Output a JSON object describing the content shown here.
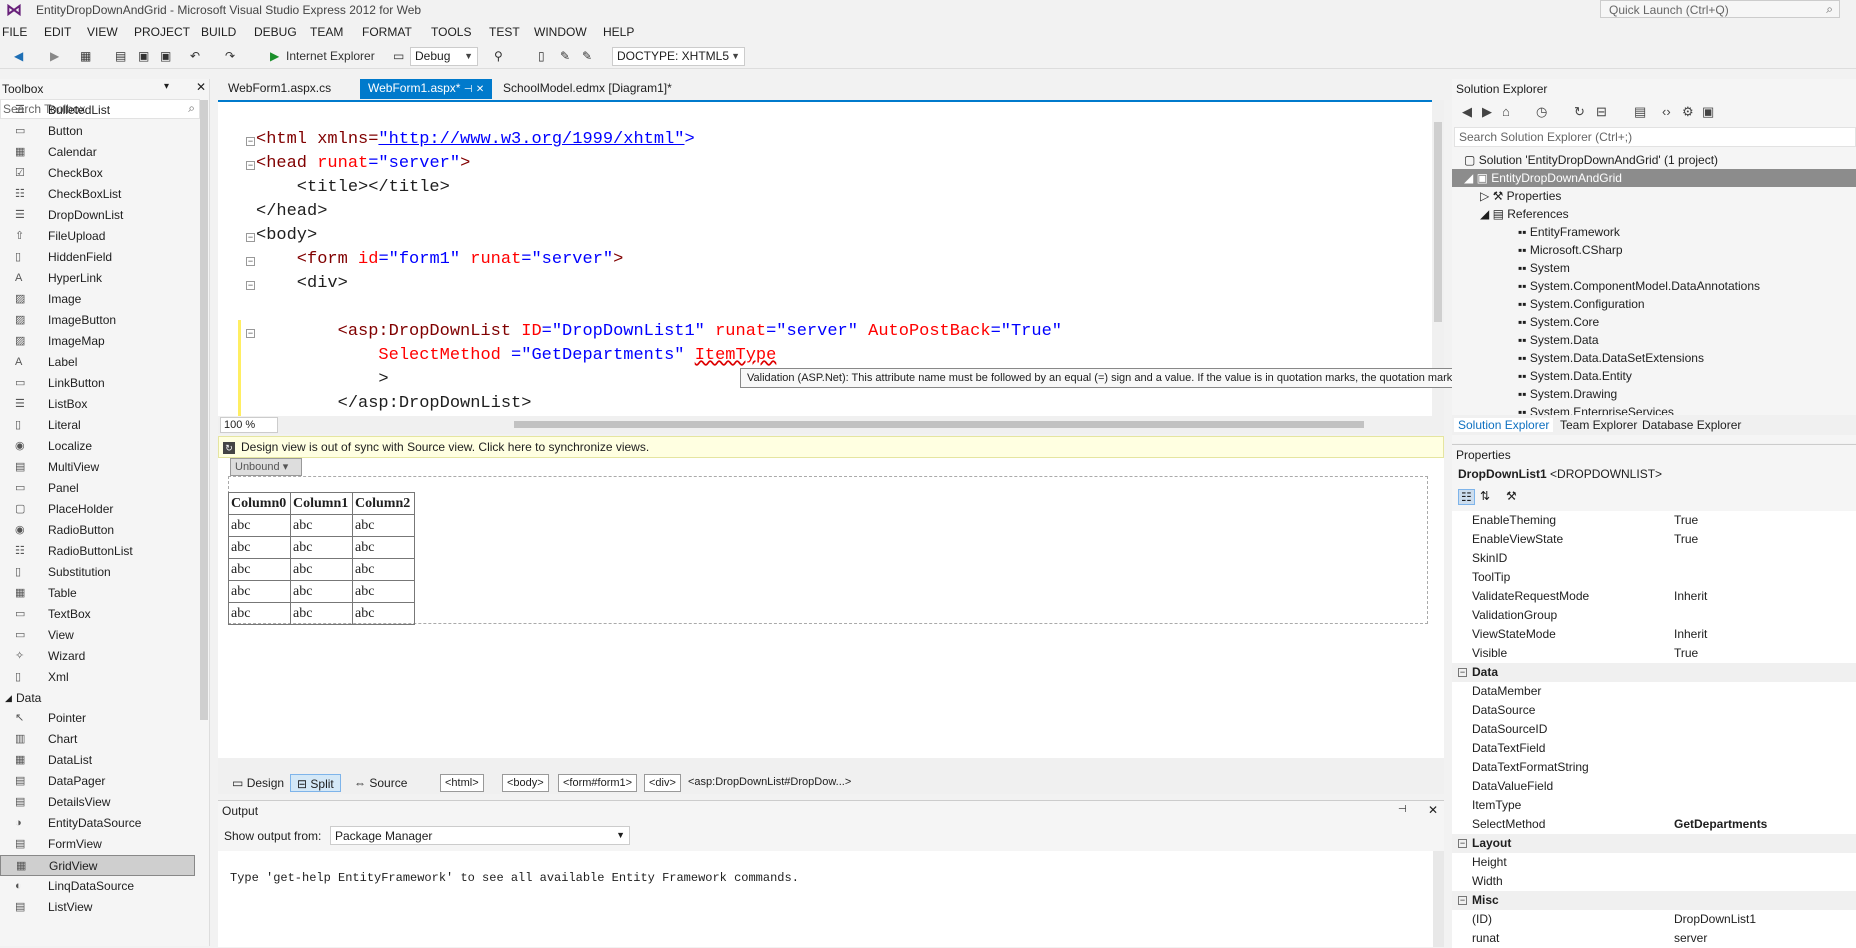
{
  "window": {
    "title": "EntityDropDownAndGrid - Microsoft Visual Studio Express 2012 for Web",
    "quick_launch": "Quick Launch (Ctrl+Q)"
  },
  "menu": [
    "FILE",
    "EDIT",
    "VIEW",
    "PROJECT",
    "BUILD",
    "DEBUG",
    "TEAM",
    "FORMAT",
    "TOOLS",
    "TEST",
    "WINDOW",
    "HELP"
  ],
  "toolbar": {
    "run_label": "Internet Explorer",
    "config": "Debug",
    "doctype": "DOCTYPE: XHTML5"
  },
  "toolbox": {
    "title": "Toolbox",
    "search_placeholder": "Search Toolbox",
    "standard_items": [
      "BulletedList",
      "Button",
      "Calendar",
      "CheckBox",
      "CheckBoxList",
      "DropDownList",
      "FileUpload",
      "HiddenField",
      "HyperLink",
      "Image",
      "ImageButton",
      "ImageMap",
      "Label",
      "LinkButton",
      "ListBox",
      "Literal",
      "Localize",
      "MultiView",
      "Panel",
      "PlaceHolder",
      "RadioButton",
      "RadioButtonList",
      "Substitution",
      "Table",
      "TextBox",
      "View",
      "Wizard",
      "Xml"
    ],
    "data_group": "Data",
    "data_items": [
      "Pointer",
      "Chart",
      "DataList",
      "DataPager",
      "DetailsView",
      "EntityDataSource",
      "FormView",
      "GridView",
      "LinqDataSource",
      "ListView"
    ]
  },
  "tabs": [
    {
      "label": "WebForm1.aspx.cs"
    },
    {
      "label": "WebForm1.aspx*"
    },
    {
      "label": "SchoolModel.edmx [Diagram1]*"
    }
  ],
  "code": {
    "l1_tag": "<html xmlns=",
    "l1_url": "\"http://www.w3.org/1999/xhtml\"",
    "l1_end": ">",
    "l2a": "<head ",
    "l2b": "runat",
    "l2c": "=\"server\"",
    "l2d": ">",
    "l3": "    <title></title>",
    "l4": "</head>",
    "l5": "<body>",
    "l6a": "    <form ",
    "l6b": "id",
    "l6c": "=\"form1\" ",
    "l6d": "runat",
    "l6e": "=\"server\"",
    "l6f": ">",
    "l7": "    <div>",
    "l8a": "        <asp:DropDownList ",
    "l8b": "ID",
    "l8c": "=\"DropDownList1\" ",
    "l8d": "runat",
    "l8e": "=\"server\" ",
    "l8f": "AutoPostBack",
    "l8g": "=\"True\"",
    "l9a": "            ",
    "l9b": "SelectMethod ",
    "l9c": "=\"GetDepartments\" ",
    "l9d": "ItemType",
    "l10": "            >",
    "l11": "        </asp:DropDownList>"
  },
  "tooltip": "Validation (ASP.Net): This attribute name must be followed by an equal (=) sign and a value. If the value is in quotation marks, the quotation marks must match.",
  "zoom": "100 %",
  "sync_message": "Design view is out of sync with Source view. Click here to synchronize views.",
  "design": {
    "dropdown": "Unbound",
    "grid_headers": [
      "Column0",
      "Column1",
      "Column2"
    ],
    "grid_rows": [
      [
        "abc",
        "abc",
        "abc"
      ],
      [
        "abc",
        "abc",
        "abc"
      ],
      [
        "abc",
        "abc",
        "abc"
      ],
      [
        "abc",
        "abc",
        "abc"
      ],
      [
        "abc",
        "abc",
        "abc"
      ]
    ]
  },
  "viewbar": {
    "design": "Design",
    "split": "Split",
    "source": "Source",
    "crumbs": [
      "<html>",
      "<body>",
      "<form#form1>",
      "<div>",
      "<asp:DropDownList#DropDow...>"
    ]
  },
  "output": {
    "title": "Output",
    "show_from": "Show output from:",
    "source": "Package Manager",
    "text": "Type 'get-help EntityFramework' to see all available Entity Framework commands."
  },
  "solution_explorer": {
    "title": "Solution Explorer",
    "search": "Search Solution Explorer (Ctrl+;)",
    "solution": "Solution 'EntityDropDownAndGrid' (1 project)",
    "project": "EntityDropDownAndGrid",
    "properties": "Properties",
    "references": "References",
    "refs": [
      "EntityFramework",
      "Microsoft.CSharp",
      "System",
      "System.ComponentModel.DataAnnotations",
      "System.Configuration",
      "System.Core",
      "System.Data",
      "System.Data.DataSetExtensions",
      "System.Data.Entity",
      "System.Drawing",
      "System.EnterpriseServices"
    ],
    "tabs": [
      "Solution Explorer",
      "Team Explorer",
      "Database Explorer"
    ]
  },
  "properties": {
    "title": "Properties",
    "object_name": "DropDownList1",
    "object_type": "<DROPDOWNLIST>",
    "rows_top": [
      {
        "n": "EnableTheming",
        "v": "True"
      },
      {
        "n": "EnableViewState",
        "v": "True"
      },
      {
        "n": "SkinID",
        "v": ""
      },
      {
        "n": "ToolTip",
        "v": ""
      },
      {
        "n": "ValidateRequestMode",
        "v": "Inherit"
      },
      {
        "n": "ValidationGroup",
        "v": ""
      },
      {
        "n": "ViewStateMode",
        "v": "Inherit"
      },
      {
        "n": "Visible",
        "v": "True"
      }
    ],
    "cat_data": "Data",
    "rows_data": [
      {
        "n": "DataMember",
        "v": ""
      },
      {
        "n": "DataSource",
        "v": ""
      },
      {
        "n": "DataSourceID",
        "v": ""
      },
      {
        "n": "DataTextField",
        "v": ""
      },
      {
        "n": "DataTextFormatString",
        "v": ""
      },
      {
        "n": "DataValueField",
        "v": ""
      },
      {
        "n": "ItemType",
        "v": ""
      },
      {
        "n": "SelectMethod",
        "v": "GetDepartments"
      }
    ],
    "cat_layout": "Layout",
    "rows_layout": [
      {
        "n": "Height",
        "v": ""
      },
      {
        "n": "Width",
        "v": ""
      }
    ],
    "cat_misc": "Misc",
    "rows_misc": [
      {
        "n": "(ID)",
        "v": "DropDownList1"
      },
      {
        "n": "runat",
        "v": "server"
      }
    ]
  }
}
